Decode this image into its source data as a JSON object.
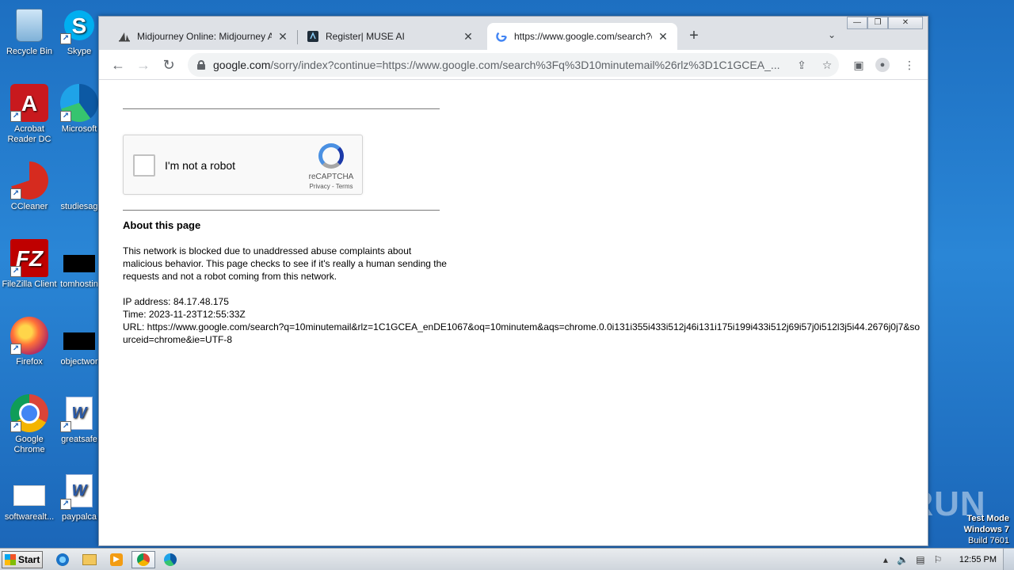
{
  "desktop": {
    "icons": [
      {
        "label": "Recycle Bin"
      },
      {
        "label": "Acrobat Reader DC"
      },
      {
        "label": "CCleaner"
      },
      {
        "label": "FileZilla Client"
      },
      {
        "label": "Firefox"
      },
      {
        "label": "Google Chrome"
      },
      {
        "label": "softwarealt..."
      },
      {
        "label": "Skype"
      },
      {
        "label": "Microsoft"
      },
      {
        "label": "studiesag"
      },
      {
        "label": "tomhostin"
      },
      {
        "label": "objectwor"
      },
      {
        "label": "greatsafe"
      },
      {
        "label": "paypalca"
      }
    ],
    "watermark": "ANY RUN",
    "test_mode": {
      "line1": "Test Mode",
      "line2": "Windows 7",
      "line3": "Build 7601"
    }
  },
  "browser": {
    "tabs": [
      {
        "title": "Midjourney Online: Midjourney Ai Onl"
      },
      {
        "title": "Register| MUSE AI"
      },
      {
        "title": "https://www.google.com/search?q="
      }
    ],
    "address": {
      "host": "google.com",
      "path": "/sorry/index?continue=https://www.google.com/search%3Fq%3D10minutemail%26rlz%3D1C1GCEA_..."
    },
    "window_controls": {
      "minimize": "—",
      "maximize": "❐",
      "close": "✕"
    }
  },
  "page": {
    "captcha": {
      "label": "I'm not a robot",
      "brand": "reCAPTCHA",
      "links": "Privacy - Terms"
    },
    "about_title": "About this page",
    "paragraph": "This network is blocked due to unaddressed abuse complaints about malicious behavior. This page checks to see if it's really a human sending the requests and not a robot coming from this network.",
    "ip_line": "IP address: 84.17.48.175",
    "time_line": "Time: 2023-11-23T12:55:33Z",
    "url_line": "URL: https://www.google.com/search?q=10minutemail&rlz=1C1GCEA_enDE1067&oq=10minutem&aqs=chrome.0.0i131i355i433i512j46i131i175i199i433i512j69i57j0i512l3j5i44.2676j0j7&sourceid=chrome&ie=UTF-8"
  },
  "taskbar": {
    "start_label": "Start",
    "clock": "12:55 PM"
  }
}
